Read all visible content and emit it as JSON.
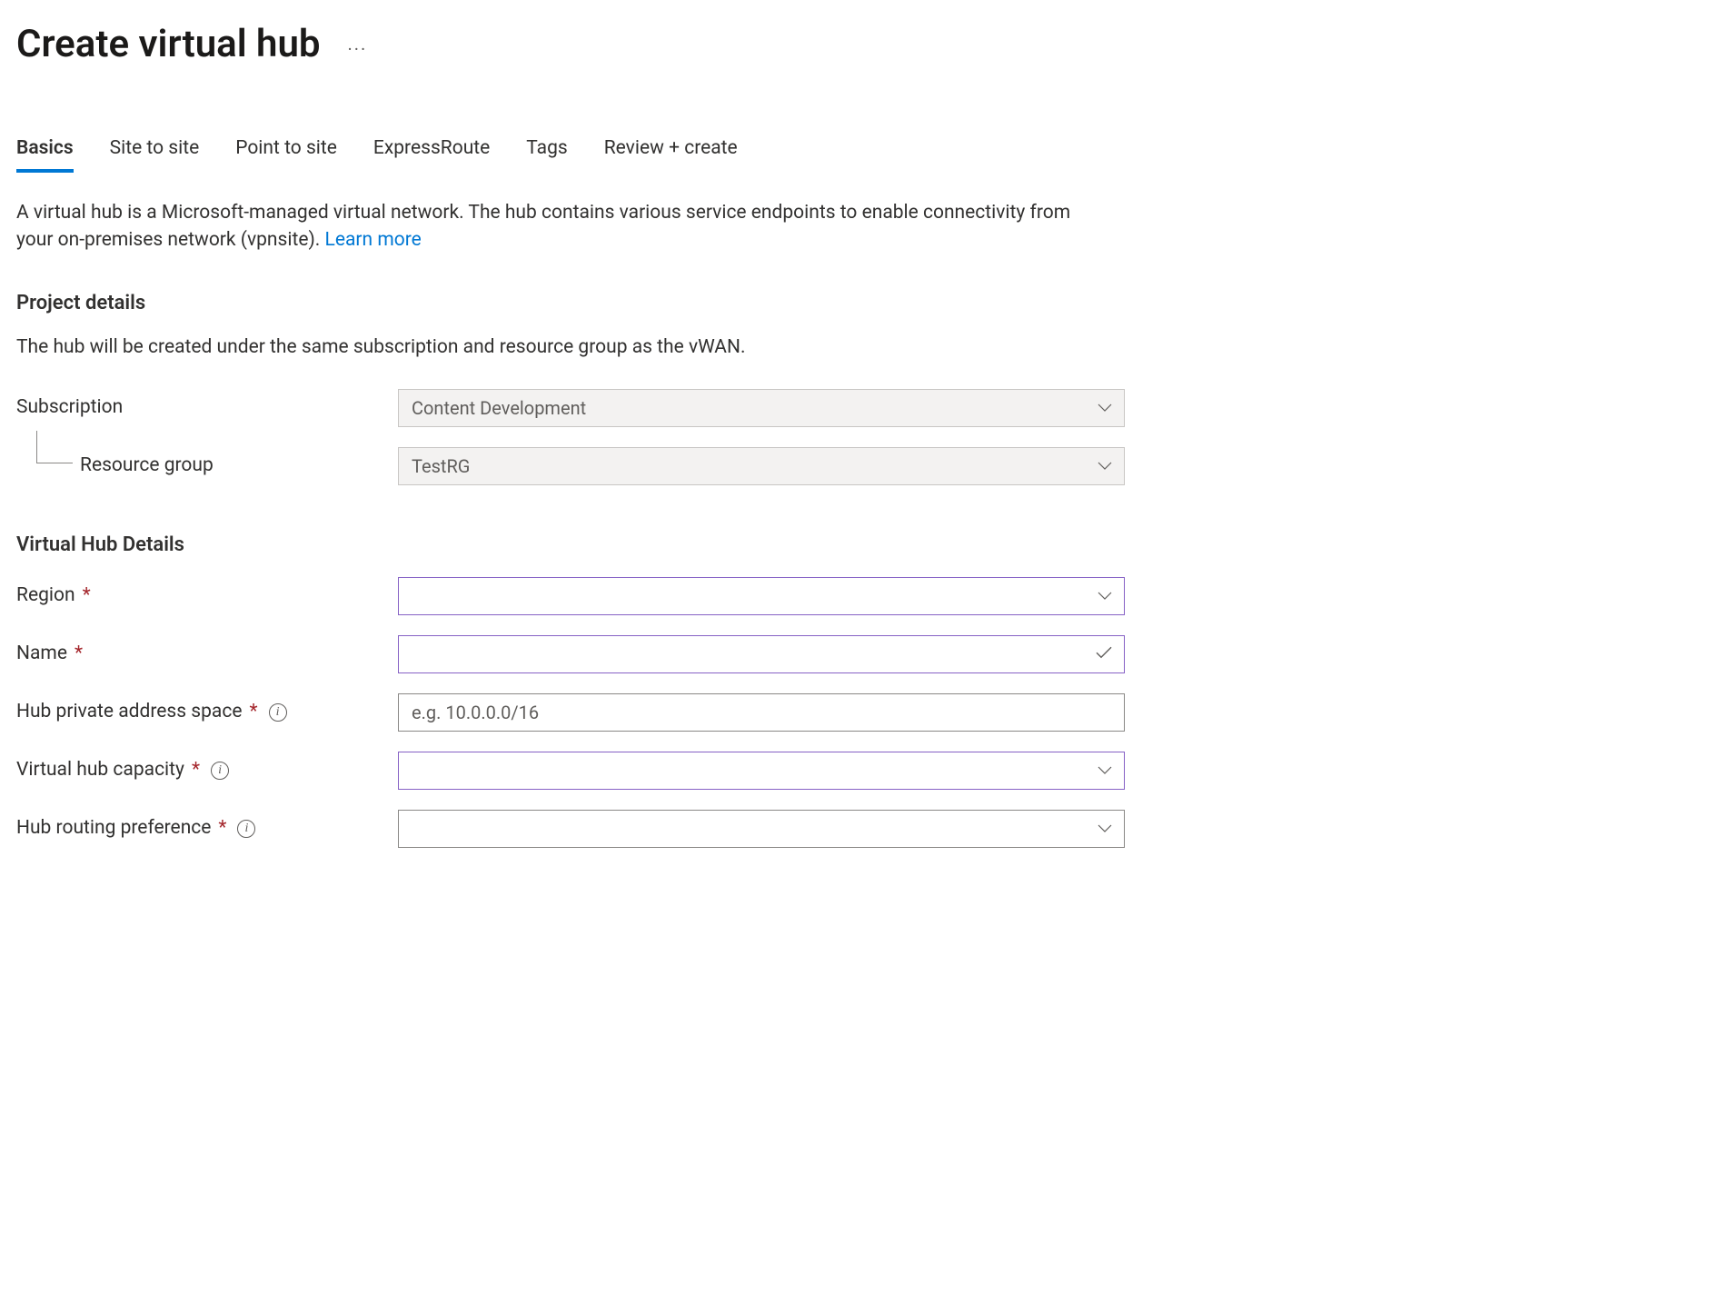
{
  "header": {
    "title": "Create virtual hub"
  },
  "tabs": [
    {
      "label": "Basics",
      "active": true
    },
    {
      "label": "Site to site",
      "active": false
    },
    {
      "label": "Point to site",
      "active": false
    },
    {
      "label": "ExpressRoute",
      "active": false
    },
    {
      "label": "Tags",
      "active": false
    },
    {
      "label": "Review + create",
      "active": false
    }
  ],
  "description": {
    "text": "A virtual hub is a Microsoft-managed virtual network. The hub contains various service endpoints to enable connectivity from your on-premises network (vpnsite). ",
    "learn_more": "Learn more"
  },
  "project_details": {
    "heading": "Project details",
    "subtext": "The hub will be created under the same subscription and resource group as the vWAN.",
    "subscription_label": "Subscription",
    "subscription_value": "Content Development",
    "resource_group_label": "Resource group",
    "resource_group_value": "TestRG"
  },
  "hub_details": {
    "heading": "Virtual Hub Details",
    "region_label": "Region",
    "region_value": "",
    "name_label": "Name",
    "name_value": "",
    "address_label": "Hub private address space",
    "address_placeholder": "e.g. 10.0.0.0/16",
    "address_value": "",
    "capacity_label": "Virtual hub capacity",
    "capacity_value": "",
    "routing_label": "Hub routing preference",
    "routing_value": ""
  }
}
